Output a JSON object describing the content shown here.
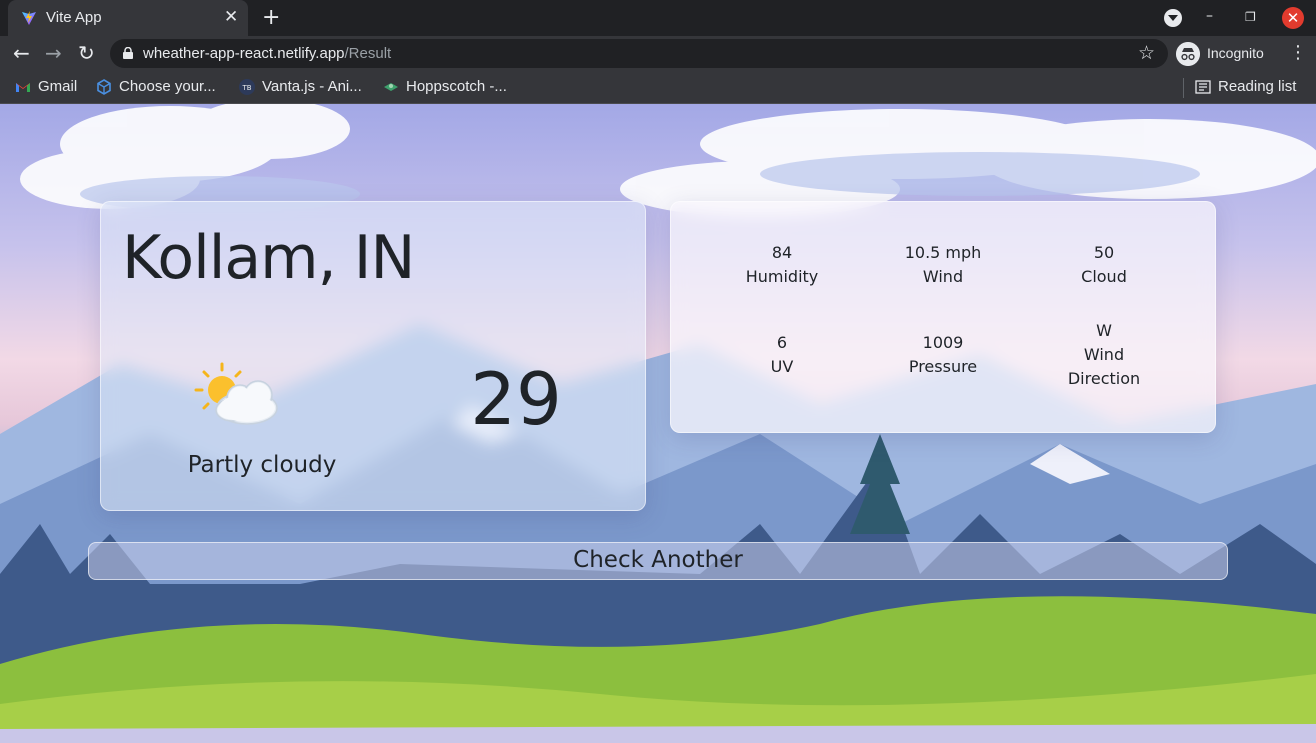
{
  "browser": {
    "tab": {
      "title": "Vite App",
      "close": "✕"
    },
    "new_tab": "+",
    "window": {
      "minimize": "–",
      "maximize": "❐",
      "close": "✕"
    },
    "nav": {
      "back": "←",
      "forward": "→",
      "reload": "↻"
    },
    "url": {
      "host": "wheather-app-react.netlify.app",
      "path": "/Result"
    },
    "star": "☆",
    "incognito_label": "Incognito",
    "menu": "⋮",
    "bookmarks": [
      {
        "label": "Gmail",
        "icon": "gmail-icon"
      },
      {
        "label": "Choose your...",
        "icon": "cube-icon"
      },
      {
        "label": "Vanta.js - Ani...",
        "icon": "tb-icon"
      },
      {
        "label": "Hoppscotch -...",
        "icon": "hoppscotch-icon"
      }
    ],
    "reading_list": "Reading list",
    "tb_glyph": "TB"
  },
  "weather": {
    "city": "Kollam, IN",
    "condition": "Partly cloudy",
    "temperature": "29",
    "icon": "partly-cloudy-icon"
  },
  "stats": [
    {
      "value": "84",
      "label": "Humidity"
    },
    {
      "value": "10.5 mph",
      "label": "Wind"
    },
    {
      "value": "50",
      "label": "Cloud"
    },
    {
      "value": "6",
      "label": "UV"
    },
    {
      "value": "1009",
      "label": "Pressure"
    },
    {
      "value": "W",
      "label": "Wind",
      "label2": "Direction"
    }
  ],
  "action": {
    "check_another": "Check Another"
  },
  "colors": {
    "tab_bg": "#35363a",
    "frame_bg": "#202124",
    "text_dark": "#1f2328",
    "close_red": "#e23b2e"
  }
}
